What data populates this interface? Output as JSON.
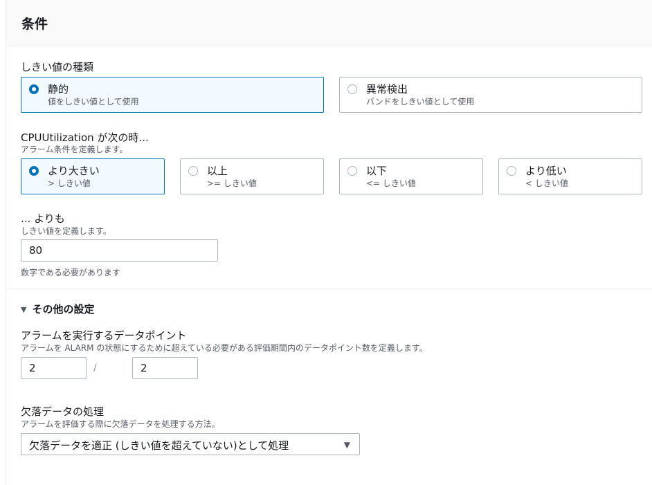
{
  "section": {
    "title": "条件"
  },
  "threshold_type": {
    "label": "しきい値の種類",
    "options": [
      {
        "title": "静的",
        "sub": "値をしきい値として使用",
        "selected": true
      },
      {
        "title": "異常検出",
        "sub": "バンドをしきい値として使用",
        "selected": false
      }
    ]
  },
  "condition": {
    "label": "CPUUtilization が次の時...",
    "desc": "アラーム条件を定義します。",
    "options": [
      {
        "title": "より大きい",
        "sub": "> しきい値",
        "selected": true
      },
      {
        "title": "以上",
        "sub": ">= しきい値",
        "selected": false
      },
      {
        "title": "以下",
        "sub": "<= しきい値",
        "selected": false
      },
      {
        "title": "より低い",
        "sub": "< しきい値",
        "selected": false
      }
    ]
  },
  "threshold": {
    "label": "... よりも",
    "desc": "しきい値を定義します。",
    "value": "80",
    "hint": "数字である必要があります"
  },
  "additional": {
    "label": "その他の設定",
    "caret": "▼"
  },
  "datapoints": {
    "label": "アラームを実行するデータポイント",
    "desc": "アラームを ALARM の状態にするために超えている必要がある評価期間内のデータポイント数を定義します。",
    "value1": "2",
    "separator": "/",
    "value2": "2"
  },
  "missing": {
    "label": "欠落データの処理",
    "desc": "アラームを評価する際に欠落データを処理する方法。",
    "selected": "欠落データを適正 (しきい値を超えていない)として処理",
    "caret": "▼"
  },
  "colors": {
    "accent": "#0073bb",
    "selected_bg": "#f1faff",
    "border": "#aab7b8"
  }
}
